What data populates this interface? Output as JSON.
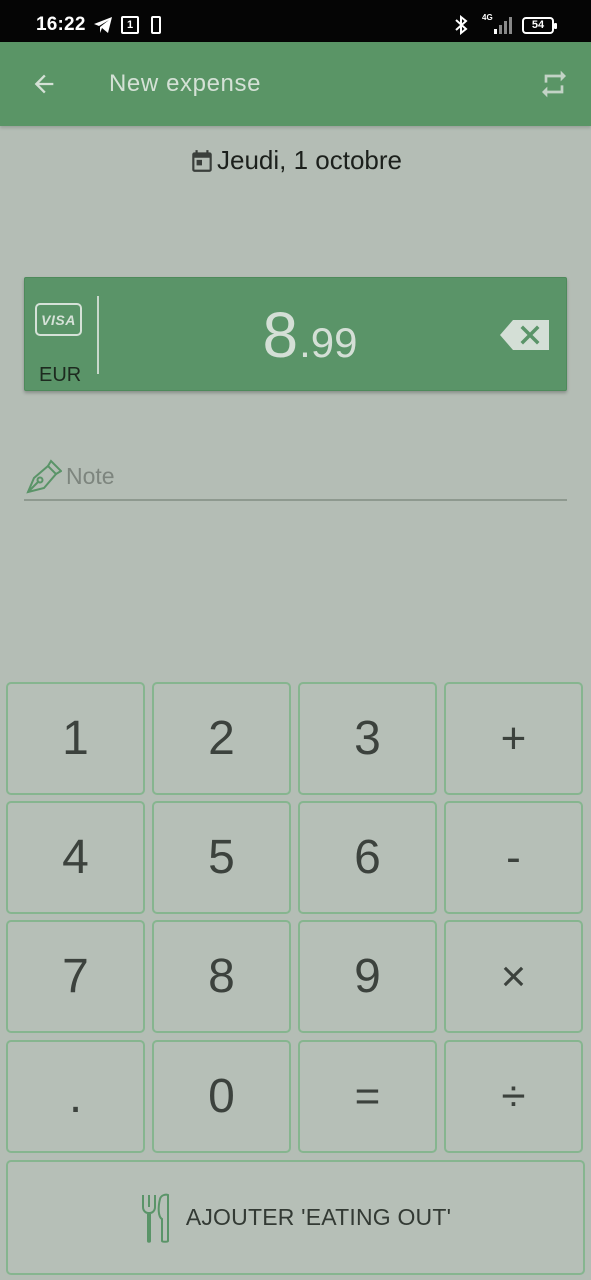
{
  "status_bar": {
    "time": "16:22",
    "notification_count": "1",
    "network": "4G",
    "battery": "54"
  },
  "app_bar": {
    "title": "New expense",
    "back_icon": "arrow-back-icon",
    "swap_icon": "repeat-icon"
  },
  "date": {
    "text": "Jeudi, 1 octobre",
    "icon": "calendar-icon"
  },
  "amount": {
    "payment_method": "VISA",
    "currency": "EUR",
    "integer": "8",
    "decimal": ".99",
    "backspace_icon": "backspace-icon"
  },
  "note": {
    "placeholder": "Note",
    "value": "",
    "icon": "pen-nib-icon"
  },
  "keypad": {
    "keys": [
      "1",
      "2",
      "3",
      "+",
      "4",
      "5",
      "6",
      "-",
      "7",
      "8",
      "9",
      "×",
      ".",
      "0",
      "=",
      "÷"
    ]
  },
  "action": {
    "label": "AJOUTER 'EATING OUT'",
    "icon": "fork-knife-icon"
  },
  "colors": {
    "app_bar": "#5a9566",
    "background": "#b4bdb5",
    "card": "#5a9468",
    "key_border": "#86b58f"
  }
}
